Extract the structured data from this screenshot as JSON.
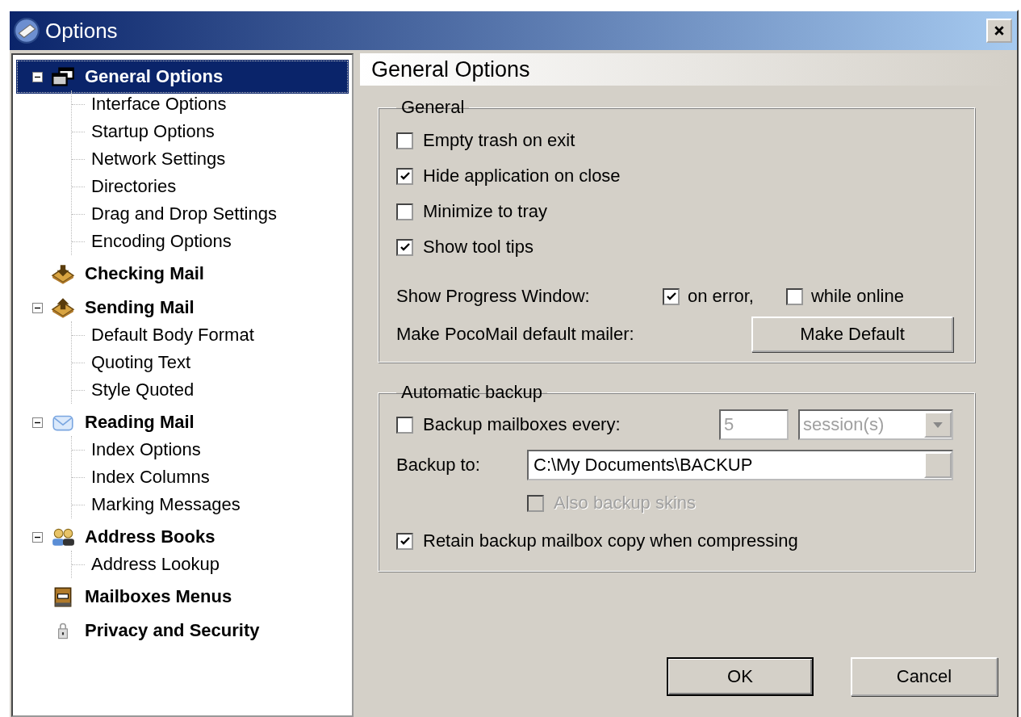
{
  "window": {
    "title": "Options"
  },
  "tree": [
    {
      "label": "General Options",
      "selected": true,
      "expanded": true,
      "children": [
        {
          "label": "Interface Options",
          "selected": false
        },
        {
          "label": "Startup Options",
          "selected": false
        },
        {
          "label": "Network Settings",
          "selected": false
        },
        {
          "label": "Directories",
          "selected": false
        },
        {
          "label": "Drag and Drop Settings",
          "selected": false
        },
        {
          "label": "Encoding Options",
          "selected": false
        }
      ]
    },
    {
      "label": "Checking Mail",
      "selected": false
    },
    {
      "label": "Sending Mail",
      "selected": false,
      "expanded": true,
      "children": [
        {
          "label": "Default Body Format",
          "selected": false
        },
        {
          "label": "Quoting Text",
          "selected": false
        },
        {
          "label": "Style Quoted",
          "selected": false
        }
      ]
    },
    {
      "label": "Reading Mail",
      "selected": false,
      "expanded": true,
      "children": [
        {
          "label": "Index Options",
          "selected": false
        },
        {
          "label": "Index Columns",
          "selected": false
        },
        {
          "label": "Marking Messages",
          "selected": false
        }
      ]
    },
    {
      "label": "Address Books",
      "selected": false,
      "expanded": true,
      "children": [
        {
          "label": "Address Lookup",
          "selected": false
        }
      ]
    },
    {
      "label": "Mailboxes Menus",
      "selected": false
    },
    {
      "label": "Privacy and Security",
      "selected": false
    }
  ],
  "page": {
    "title": "General Options"
  },
  "general": {
    "legend": "General",
    "checkboxes": [
      {
        "label": "Empty trash on exit",
        "checked": false
      },
      {
        "label": "Hide application on close",
        "checked": true
      },
      {
        "label": "Minimize to tray",
        "checked": false
      },
      {
        "label": "Show tool tips",
        "checked": true
      }
    ],
    "progress": {
      "label": "Show Progress Window:",
      "options": [
        {
          "label": "on error,",
          "checked": true
        },
        {
          "label": "while online",
          "checked": false
        }
      ]
    },
    "default_mailer": {
      "label": "Make PocoMail default mailer:",
      "button": "Make Default"
    }
  },
  "backup": {
    "legend": "Automatic backup",
    "every": {
      "label": "Backup mailboxes every:",
      "checked": false
    },
    "interval": {
      "value": "5",
      "disabled": true
    },
    "unit": {
      "value": "session(s)",
      "disabled": true
    },
    "path": {
      "label": "Backup to:",
      "value": "C:\\My Documents\\BACKUP"
    },
    "skins": {
      "label": "Also backup skins",
      "checked": false,
      "disabled": true
    },
    "retain": {
      "label": "Retain backup mailbox copy when compressing",
      "checked": true
    }
  },
  "buttons": [
    {
      "label": "OK"
    },
    {
      "label": "Cancel"
    }
  ]
}
